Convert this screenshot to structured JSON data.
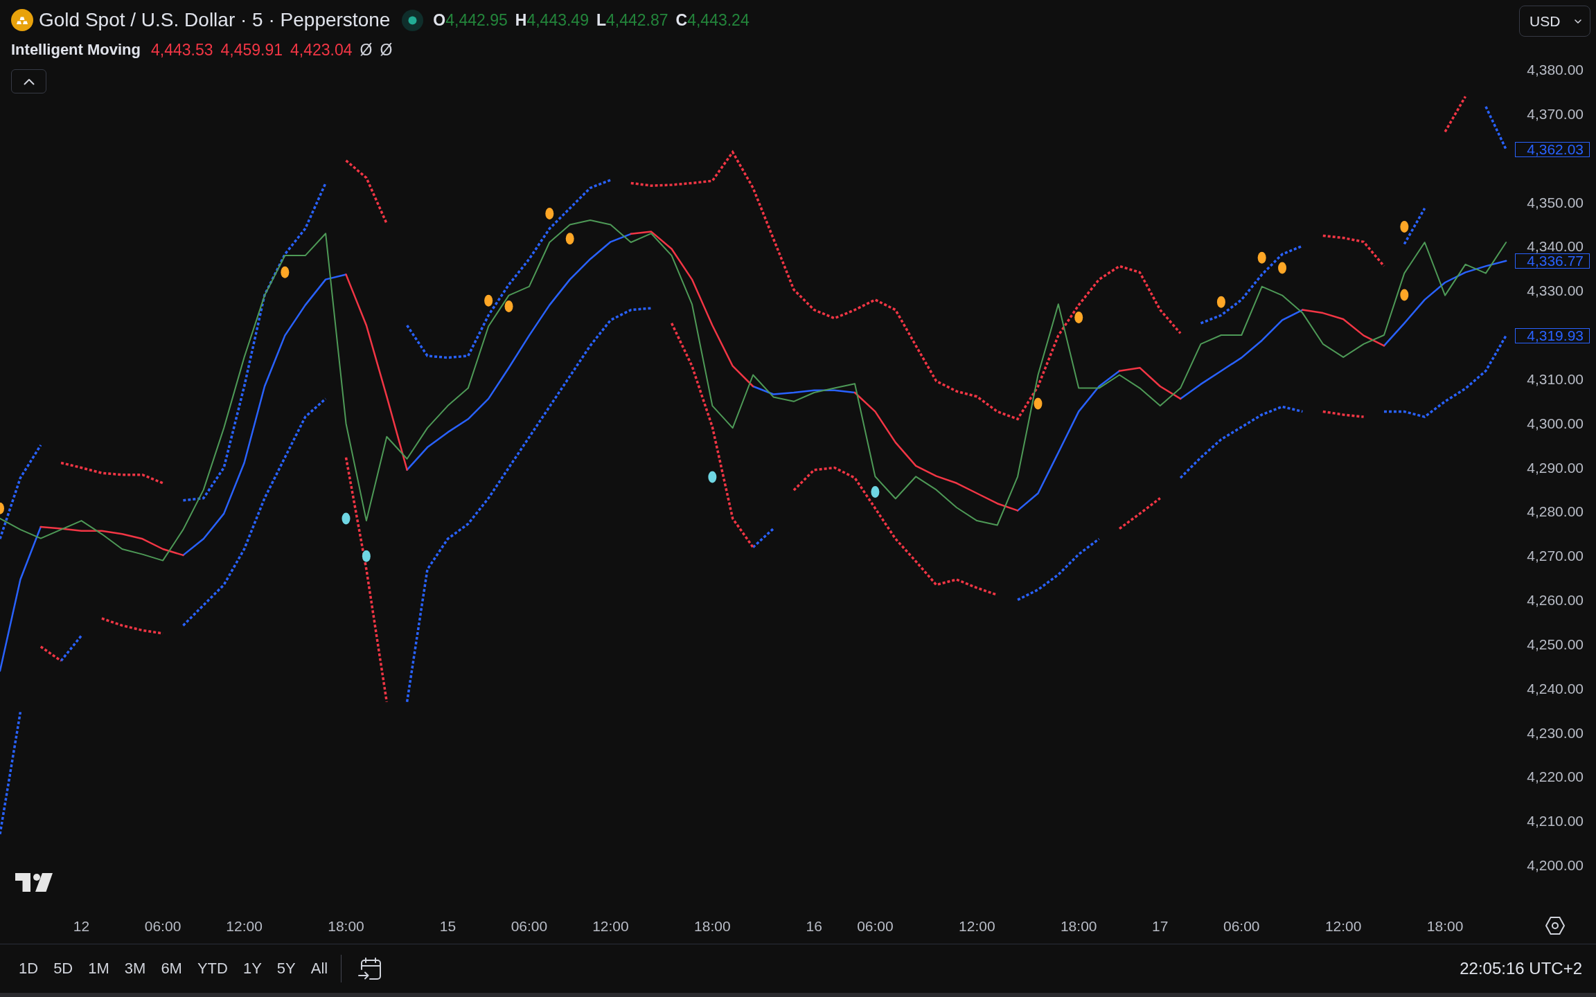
{
  "legend": {
    "symbol": "Gold Spot / U.S. Dollar · 5 · Pepperstone",
    "market_open": true,
    "rising": true,
    "ohlc": [
      {
        "label": "O",
        "value": "4,442.95"
      },
      {
        "label": "H",
        "value": "4,443.49"
      },
      {
        "label": "L",
        "value": "4,442.87"
      },
      {
        "label": "C",
        "value": "4,443.24"
      }
    ],
    "indicator": {
      "name": "Intelligent Moving",
      "values": [
        {
          "text": "4,443.53",
          "color": "#f23645"
        },
        {
          "text": "4,459.91",
          "color": "#f23645"
        },
        {
          "text": "4,423.04",
          "color": "#f23645"
        },
        {
          "text": "Ø",
          "color": "#d1d4dc"
        },
        {
          "text": "Ø",
          "color": "#d1d4dc"
        }
      ]
    },
    "expanded": true
  },
  "currency_button": {
    "label": "USD"
  },
  "chart": {
    "chart_data": {
      "type": "line",
      "categories": [
        null,
        null,
        null,
        null,
        "12",
        null,
        null,
        null,
        "06:00",
        null,
        null,
        null,
        "12:00",
        null,
        null,
        null,
        null,
        "18:00",
        null,
        null,
        null,
        null,
        "15",
        null,
        null,
        null,
        "06:00",
        null,
        null,
        null,
        "12:00",
        null,
        null,
        null,
        null,
        "18:00",
        null,
        null,
        null,
        null,
        "16",
        null,
        null,
        "06:00",
        null,
        null,
        null,
        null,
        "12:00",
        null,
        null,
        null,
        null,
        "18:00",
        null,
        null,
        null,
        "17",
        null,
        null,
        null,
        "06:00",
        null,
        null,
        null,
        null,
        "12:00",
        null,
        null,
        null,
        null,
        "18:00",
        null,
        null,
        null
      ],
      "ylim": [
        4200,
        4380
      ],
      "yticks": [
        {
          "value": 4380,
          "label": "4,380.00"
        },
        {
          "value": 4370,
          "label": "4,370.00"
        },
        {
          "value": 4350,
          "label": "4,350.00"
        },
        {
          "value": 4340,
          "label": "4,340.00"
        },
        {
          "value": 4330,
          "label": "4,330.00"
        },
        {
          "value": 4310,
          "label": "4,310.00"
        },
        {
          "value": 4300,
          "label": "4,300.00"
        },
        {
          "value": 4290,
          "label": "4,290.00"
        },
        {
          "value": 4280,
          "label": "4,280.00"
        },
        {
          "value": 4270,
          "label": "4,270.00"
        },
        {
          "value": 4260,
          "label": "4,260.00"
        },
        {
          "value": 4250,
          "label": "4,250.00"
        },
        {
          "value": 4240,
          "label": "4,240.00"
        },
        {
          "value": 4230,
          "label": "4,230.00"
        },
        {
          "value": 4220,
          "label": "4,220.00"
        },
        {
          "value": 4210,
          "label": "4,210.00"
        },
        {
          "value": 4200,
          "label": "4,200.00"
        }
      ],
      "series": [
        {
          "type": "scatter",
          "color": "#ffa726",
          "marker": "o",
          "values": [
            4280.8,
            null,
            null,
            null,
            null,
            null,
            null,
            null,
            null,
            null,
            null,
            null,
            null,
            null,
            4334.2,
            null,
            null,
            null,
            null,
            null,
            null,
            null,
            null,
            null,
            4327.8,
            4326.5,
            null,
            4347.5,
            4341.8,
            null,
            null,
            null,
            null,
            null,
            null,
            null,
            null,
            null,
            null,
            null,
            null,
            null,
            null,
            null,
            null,
            null,
            null,
            null,
            null,
            null,
            null,
            4304.5,
            null,
            4324.0,
            null,
            null,
            null,
            null,
            null,
            null,
            4327.5,
            null,
            4337.5,
            4335.2,
            null,
            null,
            null,
            null,
            null,
            4344.5,
            null,
            null,
            null,
            null,
            null
          ]
        },
        {
          "type": "scatter",
          "color": "#ffa726",
          "marker": "o",
          "values": [
            null,
            null,
            null,
            null,
            null,
            null,
            null,
            null,
            null,
            null,
            null,
            null,
            null,
            null,
            null,
            null,
            null,
            null,
            null,
            null,
            null,
            null,
            null,
            null,
            null,
            null,
            null,
            null,
            null,
            null,
            null,
            null,
            null,
            null,
            null,
            null,
            null,
            null,
            null,
            null,
            null,
            null,
            null,
            null,
            null,
            null,
            null,
            null,
            null,
            null,
            null,
            null,
            null,
            null,
            null,
            null,
            null,
            null,
            null,
            null,
            null,
            null,
            null,
            null,
            null,
            null,
            null,
            null,
            null,
            4329.1,
            null,
            null,
            null,
            null,
            null
          ]
        },
        {
          "type": "scatter",
          "color": "#6fd6e3",
          "marker": "o",
          "values": [
            null,
            null,
            null,
            null,
            null,
            null,
            null,
            null,
            null,
            null,
            null,
            null,
            null,
            null,
            null,
            null,
            null,
            4278.5,
            4270.0,
            null,
            null,
            null,
            null,
            null,
            null,
            null,
            null,
            null,
            null,
            null,
            null,
            null,
            null,
            null,
            null,
            4287.9,
            null,
            null,
            null,
            null,
            null,
            null,
            null,
            4284.5,
            null,
            null,
            null,
            null,
            null,
            null,
            null,
            null,
            null,
            null,
            null,
            null,
            null,
            null,
            null,
            null,
            null,
            null,
            null,
            null,
            null,
            null,
            null,
            null,
            null,
            null,
            null,
            null,
            null,
            null,
            null
          ]
        },
        {
          "color": "#2962ff",
          "line_style": "dotted",
          "values": [
            4273.9,
            4287.7,
            4295.1,
            null,
            null,
            null,
            null,
            null,
            null,
            4282.6,
            4283.1,
            4290.0,
            4308.4,
            4329.1,
            4338.3,
            4344.1,
            4354.4,
            null,
            null,
            null,
            4322.2,
            4315.3,
            4314.9,
            4315.3,
            4324.5,
            4331.4,
            4337.2,
            4344.1,
            4348.7,
            4353.3,
            4355.1,
            null,
            null,
            null,
            null,
            null,
            null,
            null,
            null,
            null,
            null,
            null,
            null,
            null,
            null,
            null,
            null,
            null,
            null,
            null,
            null,
            null,
            null,
            null,
            null,
            null,
            null,
            null,
            null,
            4322.7,
            4324.5,
            4328.0,
            4333.7,
            4338.3,
            4340.2,
            null,
            null,
            null,
            null,
            4340.6,
            4348.7,
            null,
            null,
            4371.7,
            4362.0
          ]
        },
        {
          "color": "#f23645",
          "line_style": "dotted",
          "values": [
            null,
            null,
            null,
            4291.1,
            4290.0,
            4288.8,
            4288.4,
            4288.4,
            4286.5,
            null,
            null,
            null,
            null,
            null,
            null,
            null,
            null,
            4359.5,
            4355.6,
            4345.2,
            null,
            null,
            null,
            null,
            null,
            null,
            null,
            null,
            null,
            null,
            null,
            4354.4,
            4353.8,
            4354.0,
            4354.4,
            4354.9,
            4361.4,
            4353.3,
            4341.8,
            4330.3,
            4325.7,
            4323.8,
            4325.7,
            4328.0,
            4325.7,
            4317.6,
            4309.6,
            4307.3,
            4306.1,
            4302.7,
            4301.0,
            4308.4,
            4319.9,
            4326.8,
            4332.6,
            4335.6,
            4334.2,
            4325.7,
            4320.4,
            null,
            null,
            null,
            null,
            null,
            null,
            4342.5,
            4342.0,
            4341.1,
            4335.6,
            null,
            null,
            4366.0,
            4374.0,
            null,
            null
          ]
        },
        {
          "color": "#2962ff",
          "values": [
            4244.0,
            4264.7,
            4276.6,
            null,
            null,
            null,
            null,
            null,
            null,
            4270.2,
            4273.9,
            4279.6,
            4291.1,
            4308.4,
            4319.9,
            4326.8,
            4332.6,
            4333.7,
            null,
            null,
            4289.5,
            4294.6,
            4298.0,
            4301.0,
            4305.6,
            4312.6,
            4319.9,
            4326.8,
            4332.6,
            4337.2,
            4341.1,
            4342.9,
            null,
            null,
            null,
            null,
            null,
            4308.4,
            4306.6,
            4307.0,
            4307.5,
            4307.5,
            4307.0,
            null,
            null,
            null,
            null,
            null,
            null,
            null,
            4280.3,
            4284.2,
            4293.4,
            4302.7,
            4308.4,
            4311.9,
            null,
            null,
            4305.6,
            4308.9,
            4311.9,
            4314.9,
            4318.8,
            4323.4,
            4325.7,
            null,
            null,
            null,
            4317.6,
            4322.7,
            4328.0,
            4331.9,
            4334.2,
            4335.6,
            4336.8
          ]
        },
        {
          "color": "#f23645",
          "values": [
            null,
            null,
            4276.6,
            4276.2,
            4275.7,
            4275.7,
            4275.0,
            4273.9,
            4271.6,
            4270.2,
            null,
            null,
            null,
            null,
            null,
            null,
            null,
            4333.7,
            4322.2,
            4306.1,
            4289.5,
            null,
            null,
            null,
            null,
            null,
            null,
            null,
            null,
            null,
            null,
            4342.9,
            4343.4,
            4339.5,
            4332.6,
            4322.2,
            4313.0,
            4308.4,
            null,
            null,
            null,
            null,
            4307.0,
            4302.7,
            4295.7,
            4290.4,
            4288.1,
            4286.5,
            4284.2,
            4281.9,
            4280.3,
            null,
            null,
            null,
            null,
            4311.9,
            4312.6,
            4308.4,
            4305.6,
            null,
            null,
            null,
            null,
            null,
            4325.7,
            4325.0,
            4323.6,
            4319.9,
            4317.6,
            null,
            null,
            null,
            null,
            null,
            null
          ]
        },
        {
          "color": "#2962ff",
          "line_style": "dotted",
          "values": [
            4207.1,
            4234.7,
            null,
            4246.3,
            4252.0,
            null,
            null,
            null,
            null,
            4254.3,
            4258.9,
            4263.5,
            4271.6,
            4283.1,
            4292.3,
            4301.5,
            4305.6,
            null,
            null,
            null,
            4237.0,
            4267.0,
            4273.9,
            4277.3,
            4283.1,
            4290.0,
            4296.9,
            4303.8,
            4310.7,
            4317.6,
            4323.4,
            4325.7,
            4326.1,
            null,
            null,
            null,
            null,
            4272.0,
            4276.2,
            null,
            null,
            null,
            null,
            null,
            null,
            null,
            null,
            null,
            null,
            null,
            4260.1,
            4262.4,
            4265.8,
            4270.4,
            4273.9,
            null,
            null,
            null,
            4287.7,
            4292.3,
            4296.4,
            4299.2,
            4302.0,
            4303.8,
            4302.7,
            null,
            null,
            null,
            4302.7,
            4302.7,
            4301.5,
            4305.0,
            4307.9,
            4311.9,
            4319.9
          ]
        },
        {
          "color": "#f23645",
          "line_style": "dotted",
          "values": [
            null,
            null,
            4249.5,
            4246.3,
            null,
            4255.9,
            4254.3,
            4253.2,
            4252.5,
            null,
            null,
            null,
            null,
            null,
            null,
            null,
            null,
            4292.3,
            4267.0,
            4237.0,
            null,
            null,
            null,
            null,
            null,
            null,
            null,
            null,
            null,
            null,
            null,
            null,
            null,
            4322.7,
            4313.0,
            4299.2,
            4278.5,
            4272.0,
            null,
            4284.9,
            4289.5,
            4290.0,
            4287.7,
            4280.8,
            4273.9,
            4268.8,
            4263.5,
            4264.7,
            4262.8,
            4261.2,
            null,
            null,
            null,
            null,
            null,
            4276.2,
            4279.6,
            4283.1,
            null,
            null,
            null,
            null,
            null,
            null,
            null,
            4302.7,
            4302.0,
            4301.5,
            null,
            null,
            null,
            null,
            null,
            null,
            null
          ]
        },
        {
          "color": "#4e9a57",
          "values": [
            4278.5,
            4276,
            4274,
            4276,
            4278,
            4275,
            4271.6,
            4270.4,
            4269,
            4276,
            4285,
            4299,
            4315,
            4329,
            4338,
            4338,
            4343,
            4300,
            4278,
            4297,
            4292,
            4299,
            4304,
            4308,
            4322,
            4329,
            4331,
            4341,
            4345,
            4346,
            4345,
            4341,
            4343,
            4338,
            4327,
            4304,
            4299,
            4311,
            4306,
            4305,
            4307,
            4308,
            4309,
            4288,
            4283,
            4288,
            4285,
            4281,
            4278,
            4277,
            4288,
            4311,
            4327,
            4308,
            4308,
            4311,
            4308,
            4304,
            4308,
            4318,
            4320,
            4320,
            4331,
            4329,
            4325,
            4318,
            4315,
            4318,
            4320,
            4334,
            4341,
            4329,
            4336,
            4334,
            4341
          ]
        }
      ]
    },
    "last_value_labels": [
      "4,362.03",
      "4,336.77",
      "4,319.93"
    ]
  },
  "bottom_toolbar": {
    "ranges": [
      "1D",
      "5D",
      "1M",
      "3M",
      "6M",
      "YTD",
      "1Y",
      "5Y",
      "All"
    ],
    "clock": "22:05:16 UTC+2"
  }
}
